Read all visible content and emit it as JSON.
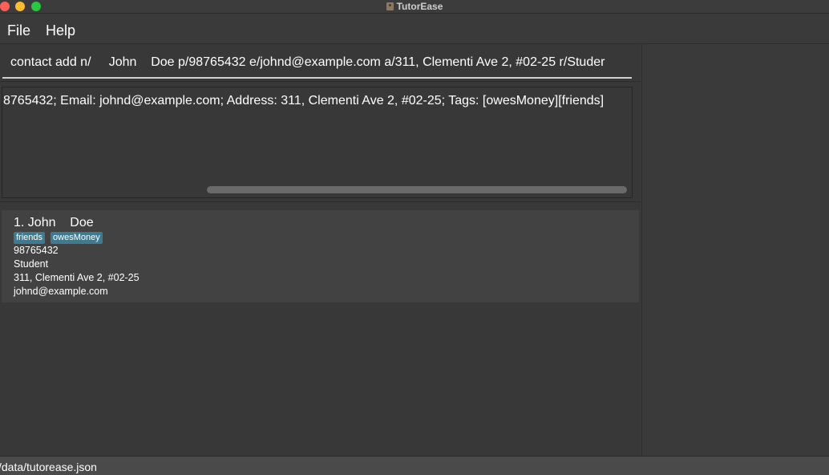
{
  "window": {
    "title": "TutorEase",
    "icon": "app-icon"
  },
  "menu": {
    "file_label": "File",
    "help_label": "Help"
  },
  "command_box": {
    "value": "contact add n/     John    Doe p/98765432 e/johnd@example.com a/311, Clementi Ave 2, #02-25 r/Studer"
  },
  "result_display": {
    "text": "8765432; Email: johnd@example.com; Address: 311, Clementi Ave 2, #02-25; Tags: [owesMoney][friends]"
  },
  "person_list": {
    "items": [
      {
        "name": "1. John    Doe",
        "tags": [
          "friends",
          "owesMoney"
        ],
        "phone": "98765432",
        "role": "Student",
        "address": "311, Clementi Ave 2, #02-25",
        "email": "johnd@example.com"
      }
    ]
  },
  "status_bar": {
    "path": "/data/tutorease.json"
  },
  "colors": {
    "background": "#3a3a3a",
    "card": "#424242",
    "tag": "#3e7b91",
    "traffic_close": "#ff5f57",
    "traffic_min": "#febc2e",
    "traffic_max": "#28c840"
  }
}
